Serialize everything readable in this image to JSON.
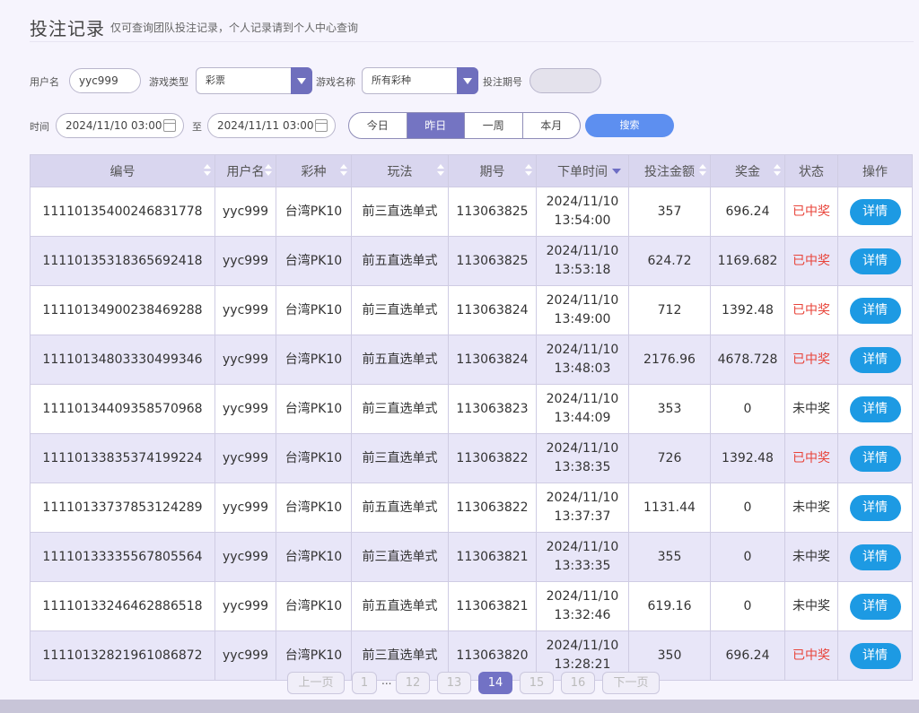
{
  "header": {
    "title": "投注记录",
    "subtitle": "仅可查询团队投注记录，个人记录请到个人中心查询"
  },
  "filters": {
    "username_label": "用户名",
    "username_value": "yyc999",
    "game_type_label": "游戏类型",
    "game_type_value": "彩票",
    "game_name_label": "游戏名称",
    "game_name_value": "所有彩种",
    "period_label": "投注期号",
    "period_value": "",
    "time_label": "时间",
    "time_from": "2024/11/10 03:00",
    "to_label": "至",
    "time_to": "2024/11/11 03:00",
    "quick_ranges": [
      "今日",
      "昨日",
      "一周",
      "本月"
    ],
    "quick_range_selected": "昨日",
    "search_label": "搜索"
  },
  "table": {
    "columns": [
      "编号",
      "用户名",
      "彩种",
      "玩法",
      "期号",
      "下单时间",
      "投注金额",
      "奖金",
      "状态",
      "操作"
    ],
    "detail_label": "详情",
    "rows": [
      {
        "id": "11110135400246831778",
        "user": "yyc999",
        "lottery": "台湾PK10",
        "play": "前三直选单式",
        "period": "113063825",
        "date": "2024/11/10",
        "time": "13:54:00",
        "amount": "357",
        "prize": "696.24",
        "status": "已中奖",
        "won": true
      },
      {
        "id": "11110135318365692418",
        "user": "yyc999",
        "lottery": "台湾PK10",
        "play": "前五直选单式",
        "period": "113063825",
        "date": "2024/11/10",
        "time": "13:53:18",
        "amount": "624.72",
        "prize": "1169.682",
        "status": "已中奖",
        "won": true
      },
      {
        "id": "11110134900238469288",
        "user": "yyc999",
        "lottery": "台湾PK10",
        "play": "前三直选单式",
        "period": "113063824",
        "date": "2024/11/10",
        "time": "13:49:00",
        "amount": "712",
        "prize": "1392.48",
        "status": "已中奖",
        "won": true
      },
      {
        "id": "11110134803330499346",
        "user": "yyc999",
        "lottery": "台湾PK10",
        "play": "前五直选单式",
        "period": "113063824",
        "date": "2024/11/10",
        "time": "13:48:03",
        "amount": "2176.96",
        "prize": "4678.728",
        "status": "已中奖",
        "won": true
      },
      {
        "id": "11110134409358570968",
        "user": "yyc999",
        "lottery": "台湾PK10",
        "play": "前三直选单式",
        "period": "113063823",
        "date": "2024/11/10",
        "time": "13:44:09",
        "amount": "353",
        "prize": "0",
        "status": "未中奖",
        "won": false
      },
      {
        "id": "11110133835374199224",
        "user": "yyc999",
        "lottery": "台湾PK10",
        "play": "前三直选单式",
        "period": "113063822",
        "date": "2024/11/10",
        "time": "13:38:35",
        "amount": "726",
        "prize": "1392.48",
        "status": "已中奖",
        "won": true
      },
      {
        "id": "11110133737853124289",
        "user": "yyc999",
        "lottery": "台湾PK10",
        "play": "前五直选单式",
        "period": "113063822",
        "date": "2024/11/10",
        "time": "13:37:37",
        "amount": "1131.44",
        "prize": "0",
        "status": "未中奖",
        "won": false
      },
      {
        "id": "11110133335567805564",
        "user": "yyc999",
        "lottery": "台湾PK10",
        "play": "前三直选单式",
        "period": "113063821",
        "date": "2024/11/10",
        "time": "13:33:35",
        "amount": "355",
        "prize": "0",
        "status": "未中奖",
        "won": false
      },
      {
        "id": "11110133246462886518",
        "user": "yyc999",
        "lottery": "台湾PK10",
        "play": "前五直选单式",
        "period": "113063821",
        "date": "2024/11/10",
        "time": "13:32:46",
        "amount": "619.16",
        "prize": "0",
        "status": "未中奖",
        "won": false
      },
      {
        "id": "11110132821961086872",
        "user": "yyc999",
        "lottery": "台湾PK10",
        "play": "前三直选单式",
        "period": "113063820",
        "date": "2024/11/10",
        "time": "13:28:21",
        "amount": "350",
        "prize": "696.24",
        "status": "已中奖",
        "won": true
      }
    ]
  },
  "pagination": {
    "prev_label": "上一页",
    "next_label": "下一页",
    "first_page": "1",
    "ellipsis": "...",
    "pages": [
      "12",
      "13",
      "14",
      "15",
      "16"
    ],
    "current_page": "14"
  },
  "colors": {
    "accent": "#7474c2",
    "won": "#e8443a",
    "detail_button": "#1d9ae3",
    "search_button": "#5d8ff0"
  }
}
